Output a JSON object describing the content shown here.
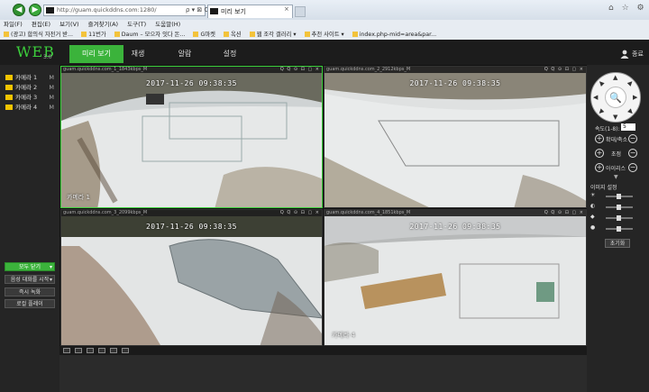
{
  "browser": {
    "address": "http://guam.quickddns.com:1280/",
    "address_tools": "ρ ▾ ⊠ C",
    "tab_title": "미리 보기",
    "tab_close": "×",
    "window_tools": "⌂ ☆ ⚙",
    "menu": [
      "파일(F)",
      "편집(E)",
      "보기(V)",
      "즐겨찾기(A)",
      "도구(T)",
      "도움말(H)"
    ],
    "favorites": [
      "(광고) 합의식 자전거 받...",
      "11번가",
      "Daum – 모으자 잇다 돈...",
      "G마켓",
      "옥션",
      "웹 조각 갤러리 ▾",
      "추천 사이트 ▾",
      "index.php-mid=area&par..."
    ]
  },
  "app": {
    "logo": "WEB",
    "version": "3.0",
    "nav": [
      "미리 보기",
      "재생",
      "알람",
      "설정"
    ],
    "user": "종료"
  },
  "sidebar": {
    "cameras": [
      {
        "label": "카메라 1",
        "mark": "M"
      },
      {
        "label": "카메라 2",
        "mark": "M"
      },
      {
        "label": "카메라 3",
        "mark": "M"
      },
      {
        "label": "카메라 4",
        "mark": "M"
      }
    ],
    "buttons": [
      "모두 닫기",
      "음성 대화를 시작",
      "즉시 녹화",
      "로컬 플레이"
    ]
  },
  "tiles": [
    {
      "head": "guam.quickddns.com_1_1843kbps_M",
      "timestamp": "2017-11-26 09:38:35",
      "label": "카메라 1"
    },
    {
      "head": "guam.quickddns.com_2_2912kbps_M",
      "timestamp": "2017-11-26 09:38:35",
      "label": ""
    },
    {
      "head": "guam.quickddns.com_3_2099kbps_M",
      "timestamp": "2017-11-26 09:38:35",
      "label": ""
    },
    {
      "head": "guam.quickddns.com_4_1851kbps_M",
      "timestamp": "2017-11-26 09:38:35",
      "label": "카메라 4"
    }
  ],
  "tile_tools": "Q Q ⊙ ⊡ ▢ ×",
  "ptz": {
    "speed_label": "속도(1-8):",
    "speed_value": "5",
    "zoom_label": "확대/축소",
    "focus_label": "초점",
    "iris_label": "아이리스",
    "image_settings_label": "이미지 설정",
    "default_button": "초기화"
  },
  "colors": {
    "accent": "#3bb33b",
    "header_bg": "#1c1c1c"
  }
}
